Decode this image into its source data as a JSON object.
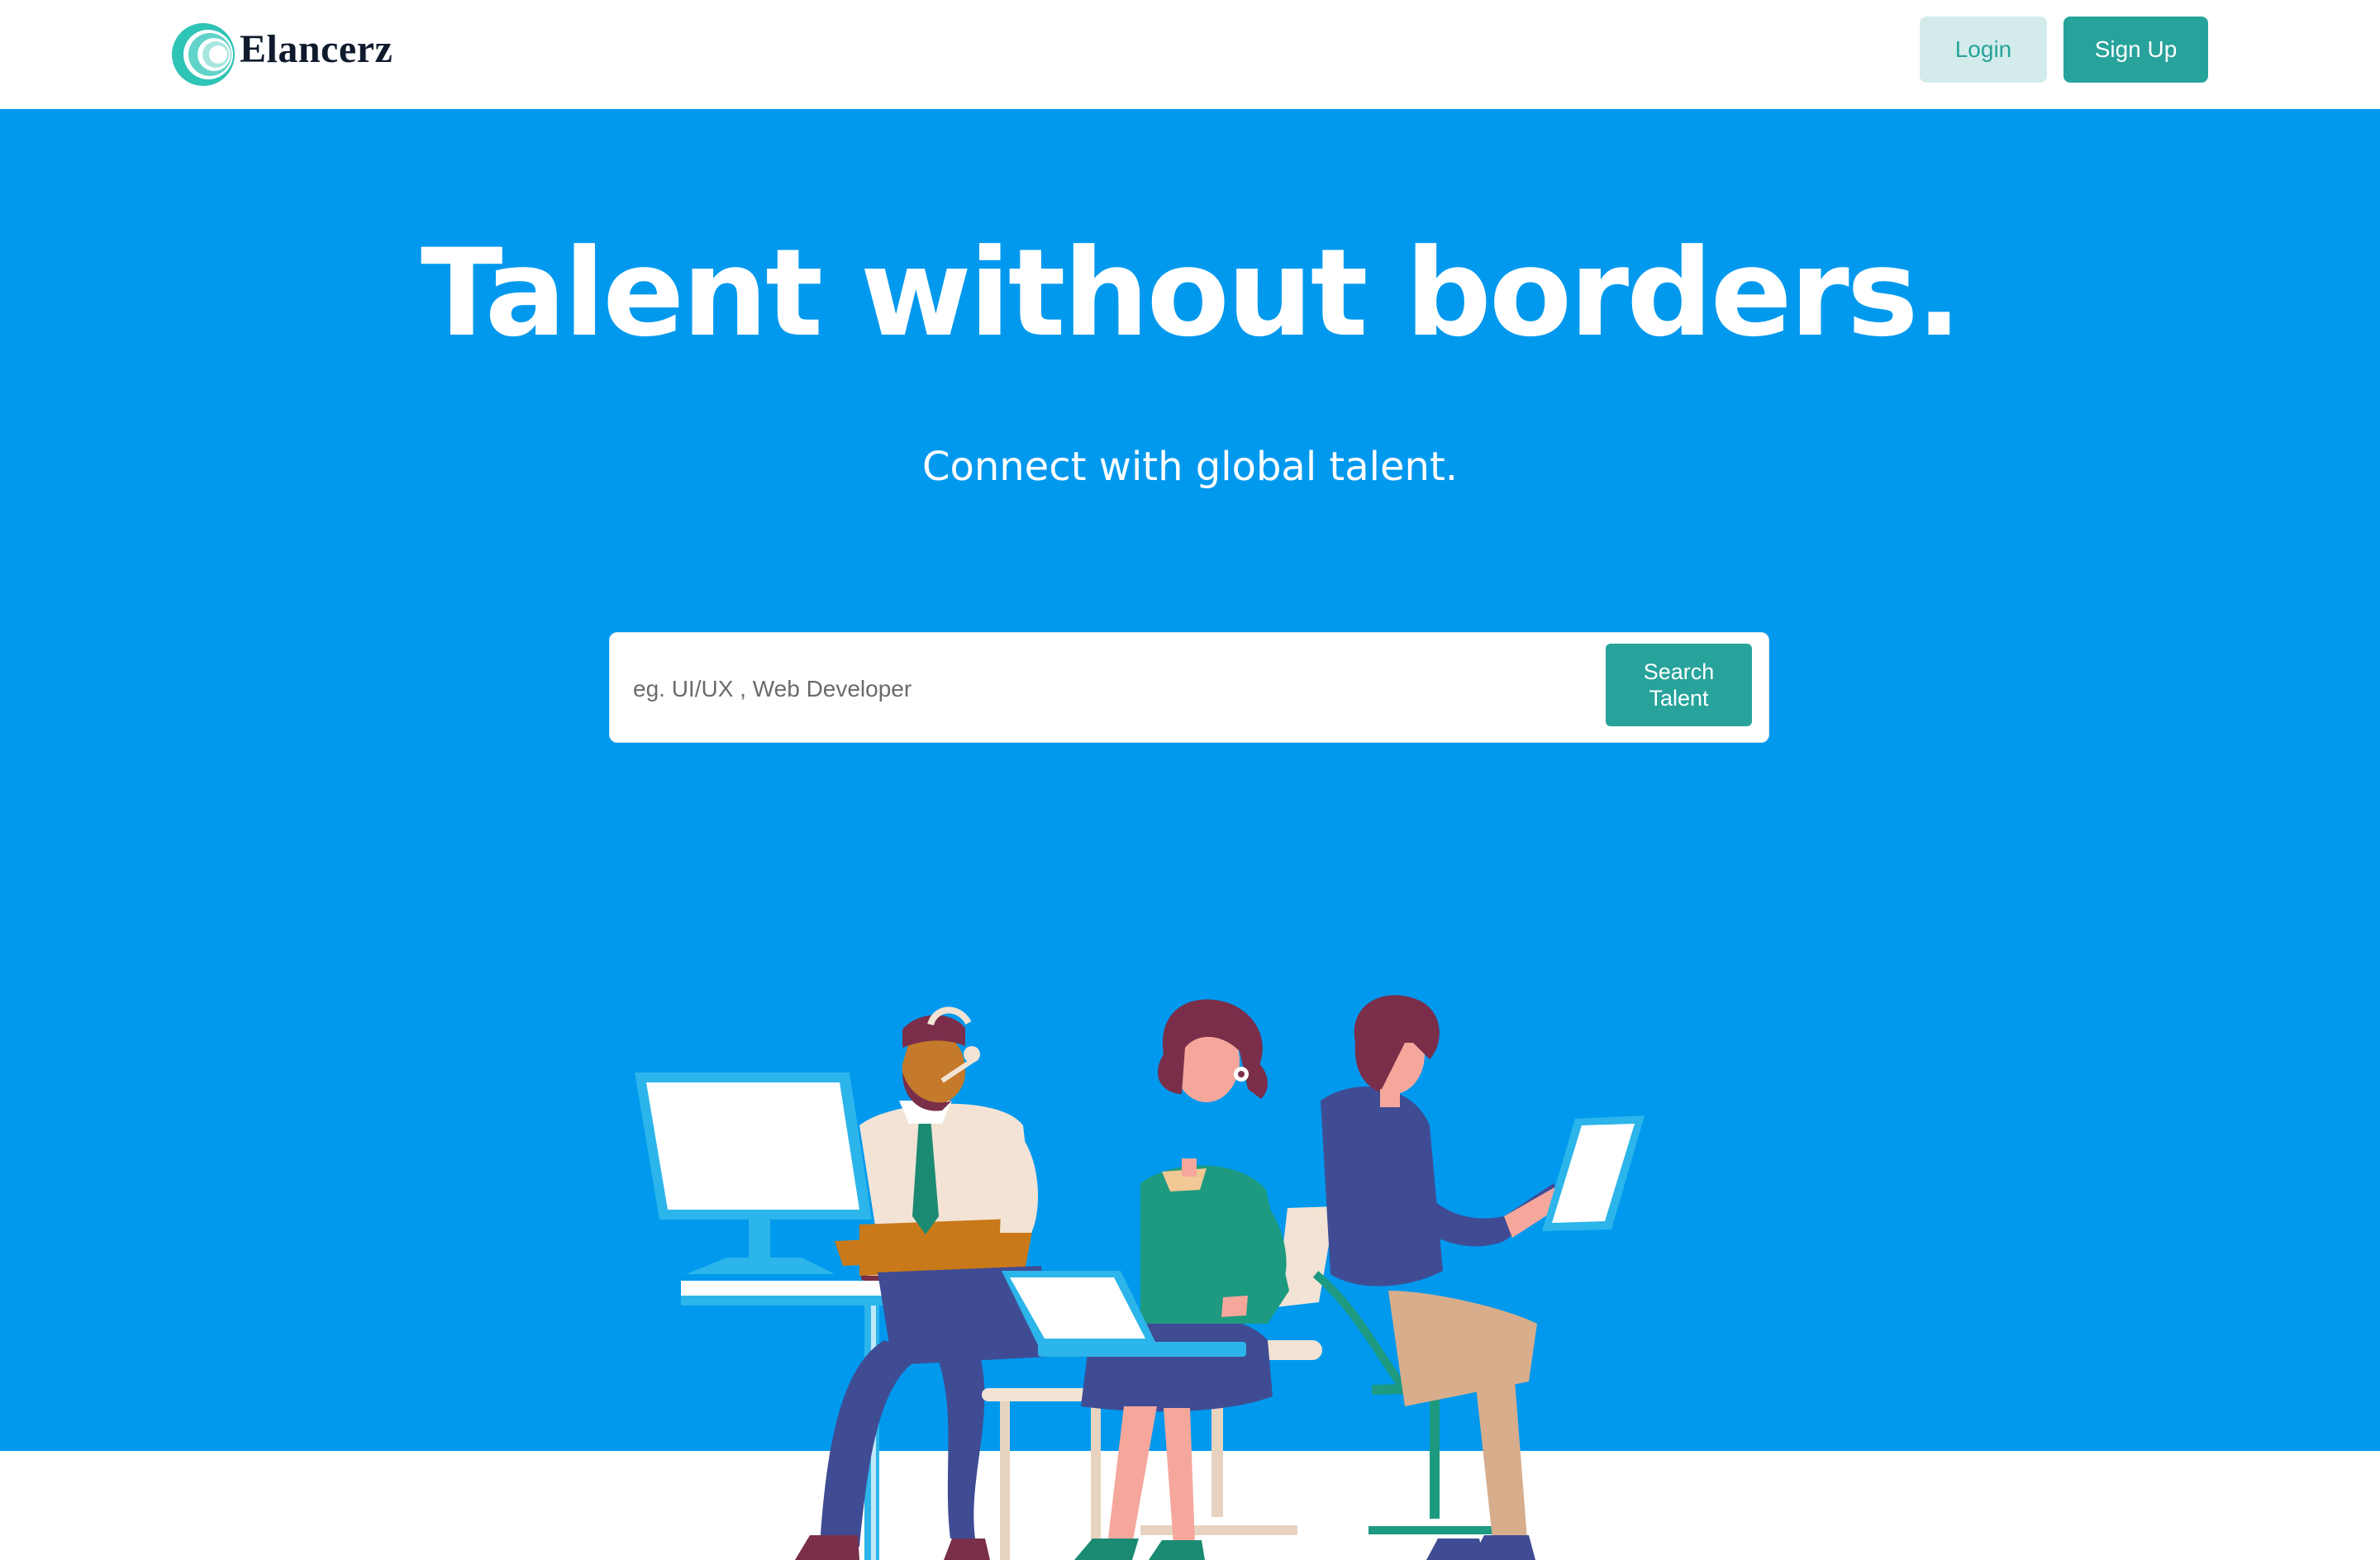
{
  "header": {
    "brand": "Elancerz",
    "logo_icon": "concentric-circles-logo",
    "login_label": "Login",
    "signup_label": "Sign Up"
  },
  "hero": {
    "headline": "Talent without borders.",
    "subline": "Connect with global talent.",
    "search": {
      "placeholder": "eg. UI/UX , Web Developer",
      "value": "",
      "button_label": "Search\nTalent"
    },
    "illustration": "three-people-working-with-computers"
  },
  "colors": {
    "hero_bg": "#0099ee",
    "accent": "#27a39b",
    "login_bg": "#d3eceb",
    "brand_text": "#0f1b2d"
  }
}
